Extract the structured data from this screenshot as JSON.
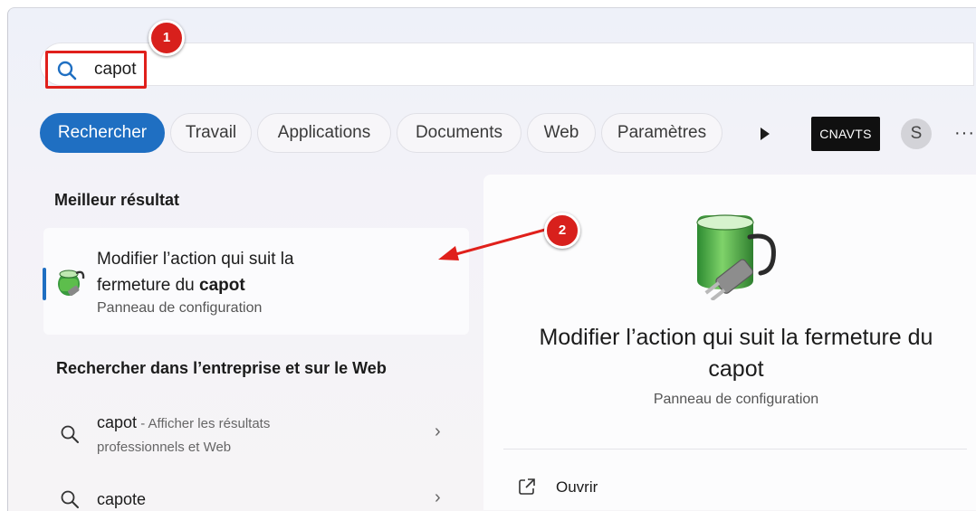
{
  "search": {
    "query": "capot"
  },
  "callouts": [
    "1",
    "2"
  ],
  "filters": [
    {
      "label": "Rechercher",
      "active": true
    },
    {
      "label": "Travail"
    },
    {
      "label": "Applications"
    },
    {
      "label": "Documents"
    },
    {
      "label": "Web"
    },
    {
      "label": "Paramètres"
    }
  ],
  "account": {
    "org_badge": "CNAVTS",
    "avatar_initial": "S",
    "more": "···"
  },
  "best_match": {
    "heading": "Meilleur résultat",
    "title_prefix": "Modifier l’action qui suit la fermeture du ",
    "title_bold": "capot",
    "subtitle": "Panneau de configuration"
  },
  "web_section": {
    "heading": "Rechercher dans l’entreprise et sur le Web",
    "items": [
      {
        "term": "capot",
        "desc": " - Afficher les résultats",
        "desc2": "professionnels et Web"
      },
      {
        "term": "capote"
      }
    ]
  },
  "preview": {
    "title": "Modifier l’action qui suit la fermeture du capot",
    "subtitle": "Panneau de configuration",
    "actions": [
      {
        "label": "Ouvrir",
        "icon": "open-external-icon"
      }
    ]
  },
  "colors": {
    "accent": "#1f6fc2",
    "annotation_red": "#e0201b"
  }
}
